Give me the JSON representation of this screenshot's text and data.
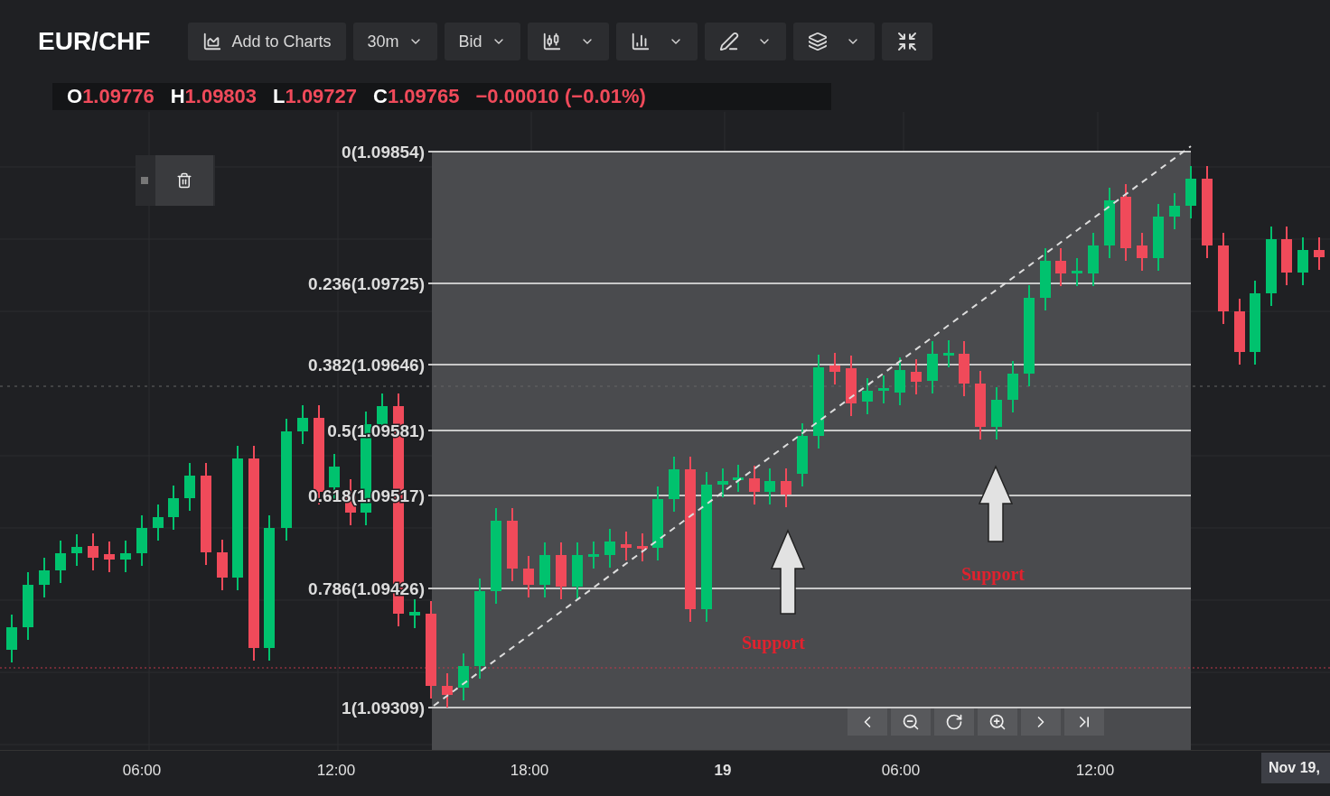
{
  "symbol": "EUR/CHF",
  "toolbar": [
    {
      "kind": "add",
      "label": "Add to Charts"
    },
    {
      "kind": "select",
      "label": "30m"
    },
    {
      "kind": "select",
      "label": "Bid"
    },
    {
      "kind": "menu"
    },
    {
      "kind": "menu"
    },
    {
      "kind": "menu"
    },
    {
      "kind": "menu"
    },
    {
      "kind": "icon"
    }
  ],
  "ohlc": [
    {
      "label": "O",
      "value": "1.09776"
    },
    {
      "label": "H",
      "value": "1.09803"
    },
    {
      "label": "L",
      "value": "1.09727"
    },
    {
      "label": "C",
      "value": "1.09765"
    }
  ],
  "change": "−0.00010 (−0.01%)",
  "fib_levels": [
    {
      "label": "0(1.09854)"
    },
    {
      "label": "0.236(1.09725)"
    },
    {
      "label": "0.382(1.09646)"
    },
    {
      "label": "0.5(1.09581)"
    },
    {
      "label": "0.618(1.09517)"
    },
    {
      "label": "0.786(1.09426)"
    },
    {
      "label": "1(1.09309)"
    }
  ],
  "annotations": [
    {
      "text": "Support"
    },
    {
      "text": "Support"
    }
  ],
  "time_axis": [
    {
      "text": "06:00",
      "kind": "time"
    },
    {
      "text": "12:00",
      "kind": "time"
    },
    {
      "text": "18:00",
      "kind": "time"
    },
    {
      "text": "19",
      "kind": "day"
    },
    {
      "text": "06:00",
      "kind": "time"
    },
    {
      "text": "12:00",
      "kind": "time"
    }
  ],
  "cursor_date": "Nov 19,"
}
